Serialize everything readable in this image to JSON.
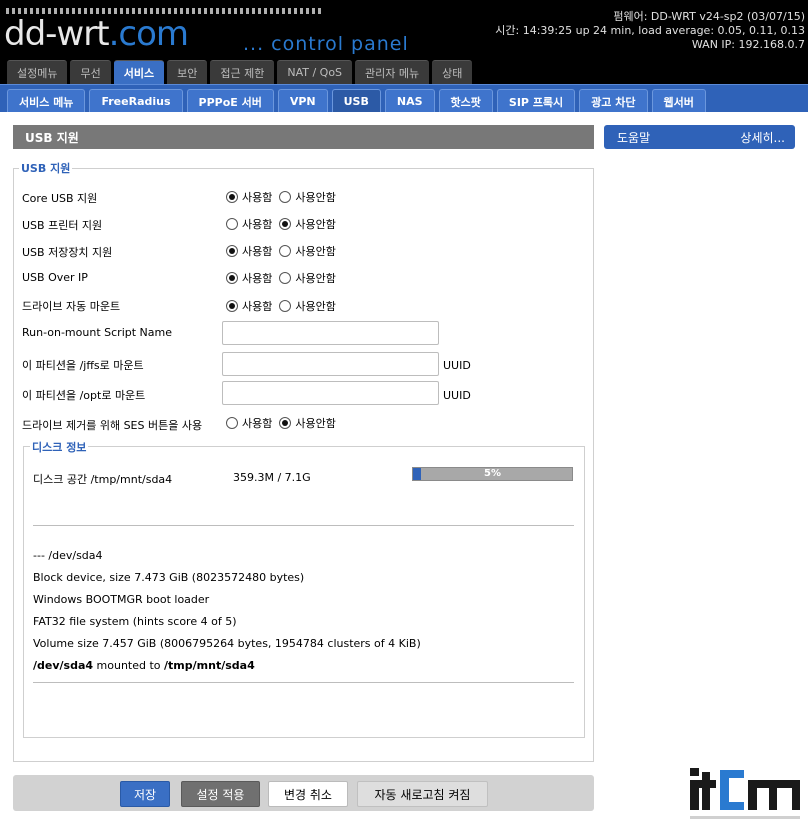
{
  "header": {
    "logo_main": "dd-wrt",
    "logo_suffix": ".com",
    "control_panel": "... control panel",
    "firmware": "펌웨어: DD-WRT v24-sp2 (03/07/15)",
    "uptime": "시간: 14:39:25 up 24 min, load average: 0.05, 0.11, 0.13",
    "wan_ip": "WAN IP: 192.168.0.7"
  },
  "main_tabs": [
    {
      "label": "설정메뉴"
    },
    {
      "label": "무선"
    },
    {
      "label": "서비스"
    },
    {
      "label": "보안"
    },
    {
      "label": "접근 제한"
    },
    {
      "label": "NAT / QoS"
    },
    {
      "label": "관리자 메뉴"
    },
    {
      "label": "상태"
    }
  ],
  "sub_tabs": [
    {
      "label": "서비스 메뉴"
    },
    {
      "label": "FreeRadius"
    },
    {
      "label": "PPPoE 서버"
    },
    {
      "label": "VPN"
    },
    {
      "label": "USB"
    },
    {
      "label": "NAS"
    },
    {
      "label": "핫스팟"
    },
    {
      "label": "SIP 프록시"
    },
    {
      "label": "광고 차단"
    },
    {
      "label": "웹서버"
    }
  ],
  "section_title": "USB 지원",
  "help": {
    "title": "도움말",
    "more": "상세히..."
  },
  "usb": {
    "legend": "USB 지원",
    "enable_label": "사용함",
    "disable_label": "사용안함",
    "rows": [
      {
        "label": "Core USB 지원",
        "enabled": true
      },
      {
        "label": "USB 프린터 지원",
        "enabled": false
      },
      {
        "label": "USB 저장장치 지원",
        "enabled": true
      },
      {
        "label": "USB Over IP",
        "enabled": true
      },
      {
        "label": "드라이브 자동 마운트",
        "enabled": true
      }
    ],
    "script_label": "Run-on-mount Script Name",
    "jffs_label": "이 파티션을 /jffs로 마운트",
    "opt_label": "이 파티션을 /opt로 마운트",
    "uuid_label": "UUID",
    "ses_label": "드라이브 제거를 위해 SES 버튼을 사용",
    "ses_enabled": false
  },
  "disk": {
    "legend": "디스크 정보",
    "space_label": "디스크 공간 /tmp/mnt/sda4",
    "space_value": "359.3M / 7.1G",
    "percent_text": "5%",
    "percent": 0.05,
    "lines": [
      "--- /dev/sda4",
      "Block device, size 7.473 GiB (8023572480 bytes)",
      "Windows BOOTMGR boot loader",
      "FAT32 file system (hints score 4 of 5)",
      "Volume size 7.457 GiB (8006795264 bytes, 1954784 clusters of 4 KiB)"
    ],
    "mount_device": "/dev/sda4",
    "mount_text": " mounted to ",
    "mount_point": "/tmp/mnt/sda4"
  },
  "buttons": {
    "save": "저장",
    "apply": "설정 적용",
    "cancel": "변경 취소",
    "refresh": "자동 새로고침 켜짐"
  },
  "colors": {
    "accent": "#2f62b8",
    "header_bg": "#000000"
  }
}
